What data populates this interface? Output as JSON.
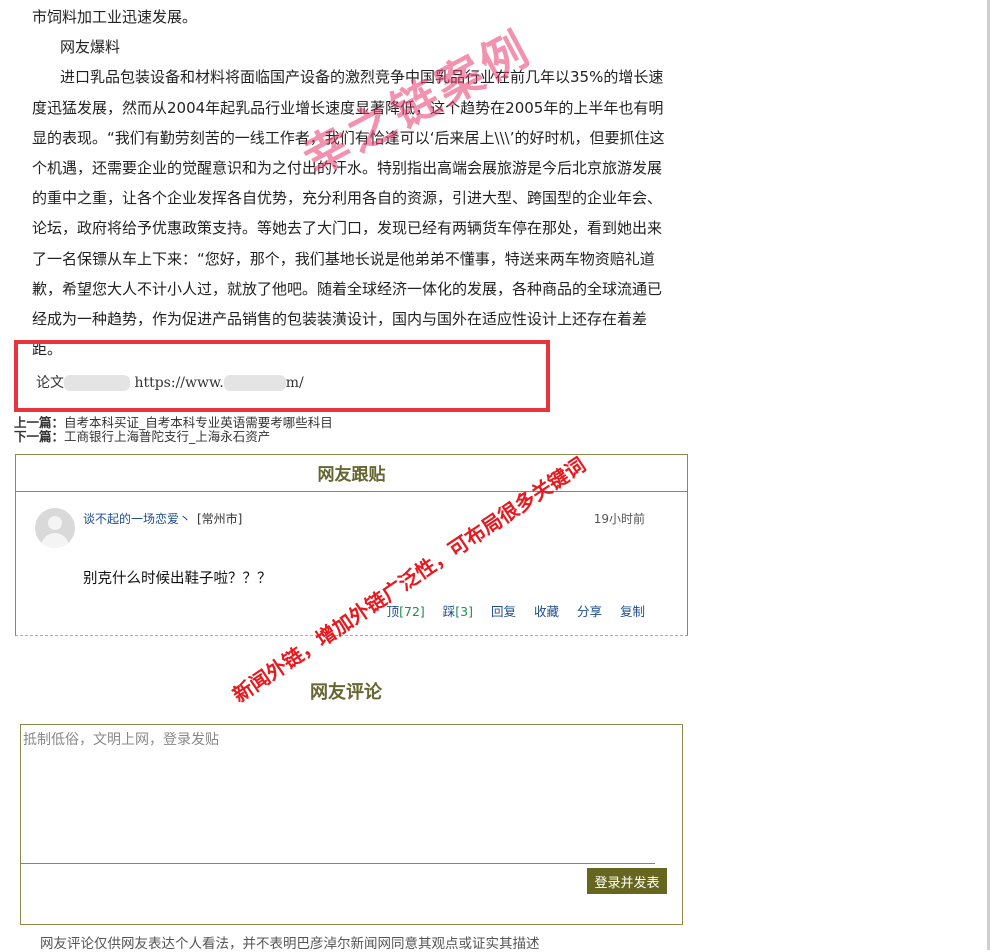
{
  "article": {
    "lead_line": "市饲料加工业迅速发展。",
    "subhead": "网友爆料",
    "body": "进口乳品包装设备和材料将面临国产设备的激烈竞争中国乳品行业在前几年以35%的增长速度迅猛发展，然而从2004年起乳品行业增长速度显著降低，这个趋势在2005年的上半年也有明显的表现。“我们有勤劳刻苦的一线工作者，我们有恰逢可以‘后来居上\\\\\\’的好时机，但要抓住这个机遇，还需要企业的觉醒意识和为之付出的汗水。特别指出高端会展旅游是今后北京旅游发展的重中之重，让各个企业发挥各自优势，充分利用各自的资源，引进大型、跨国型的企业年会、论坛，政府将给予优惠政策支持。等她去了大门口，发现已经有两辆货车停在那处，看到她出来了一名保镖从车上下来：“您好，那个，我们基地长说是他弟弟不懂事，特送来两车物资赔礼道歉，希望您大人不计小人过，就放了他吧。随着全球经济一体化的发展，各种商品的全球流通已经成为一种趋势，作为促进产品销售的包装装潢设计，国内与国外在适应性设计上还存在着差距。"
  },
  "source": {
    "prefix": "论文",
    "url_start": "https://www.",
    "url_end": "m/"
  },
  "nav": {
    "prev_label": "上一篇：",
    "prev_title": "自考本科买证_自考本科专业英语需要考哪些科目",
    "next_label": "下一篇：",
    "next_title": "工商银行上海普陀支行_上海永石资产"
  },
  "comments": {
    "title": "网友跟贴",
    "items": [
      {
        "user": "谈不起的一场恋爱丶",
        "location": "[常州市]",
        "time": "19小时前",
        "text": "别克什么时候出鞋子啦？？？",
        "up_label": "顶",
        "up_count": "[72]",
        "down_label": "踩",
        "down_count": "[3]",
        "reply": "回复",
        "favorite": "收藏",
        "share": "分享",
        "copy": "复制"
      }
    ]
  },
  "review": {
    "title": "网友评论",
    "placeholder": "抵制低俗，文明上网，登录发贴",
    "submit": "登录并发表",
    "disclaimer": "网友评论仅供网友表达个人看法，并不表明巴彦淖尔新闻网同意其观点或证实其描述"
  },
  "watermarks": {
    "main": "幸之链案例",
    "note": "新闻外链，增加外链广泛性，可布局很多关键词"
  },
  "colors": {
    "highlight_box": "#e8343c",
    "section_title": "#666633",
    "link": "#1d4d8f",
    "button": "#66661e"
  }
}
